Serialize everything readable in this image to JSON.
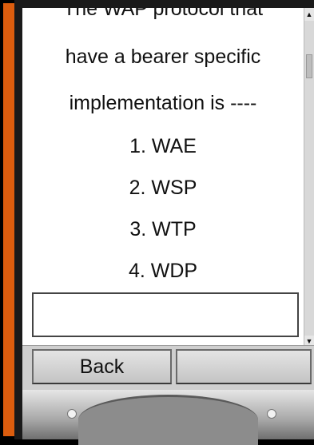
{
  "question": {
    "lines": [
      "The WAP protocol that",
      "have a bearer specific",
      "implementation is ----"
    ]
  },
  "options": [
    "1. WAE",
    "2. WSP",
    "3. WTP",
    "4. WDP"
  ],
  "answer_input": {
    "value": ""
  },
  "softkeys": {
    "left": "Back",
    "right": ""
  }
}
